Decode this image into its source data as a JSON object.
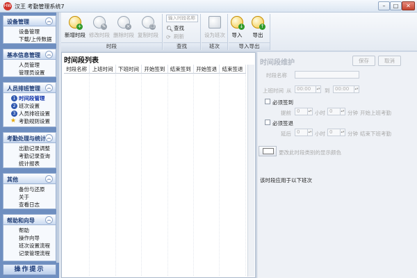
{
  "window": {
    "icon_text": "HW",
    "title": "汉王 考勤管理系统7",
    "minimize": "–",
    "maximize": "□",
    "close": "✕"
  },
  "sidebar": {
    "sections": [
      {
        "title": "设备管理",
        "items": [
          "设备管理",
          "下载/上传数据"
        ]
      },
      {
        "title": "基本信息管理",
        "items": [
          "人员管理",
          "管理员设置"
        ]
      },
      {
        "title": "人员排班管理",
        "items": [
          {
            "num": "1",
            "label": "时间段管理",
            "active": true
          },
          {
            "num": "2",
            "label": "班次设置"
          },
          {
            "num": "3",
            "label": "人员排班设置"
          },
          {
            "star": "★",
            "label": "考勤规则设置"
          }
        ]
      },
      {
        "title": "考勤处理与统计",
        "items": [
          "出勤记录调整",
          "考勤记录查询",
          "统计报表"
        ]
      },
      {
        "title": "其他",
        "items": [
          "备份与还原",
          "关于",
          "查看日志"
        ]
      },
      {
        "title": "帮助和向导",
        "items": [
          "帮助",
          "操作向导",
          "班次设置流程",
          "记录管理流程"
        ]
      }
    ],
    "collapse_glyph": "︽",
    "tip_label": "操作提示"
  },
  "toolbar": {
    "group_timeslot": {
      "label": "时段",
      "buttons": [
        {
          "label": "新增时段",
          "enabled": true,
          "badge": "+"
        },
        {
          "label": "修改时段",
          "enabled": false,
          "badge": "✎"
        },
        {
          "label": "删除时段",
          "enabled": false,
          "badge": "×"
        },
        {
          "label": "复制时段",
          "enabled": false,
          "badge": "❐"
        }
      ]
    },
    "group_search": {
      "label": "查找",
      "input_placeholder": "输入时段名称",
      "find_label": "查找",
      "refresh_label": "刷新"
    },
    "group_shift": {
      "label": "班次",
      "button_label": "设为班次"
    },
    "group_io": {
      "label": "导入导出",
      "import_label": "导入",
      "export_label": "导出"
    }
  },
  "list_panel": {
    "title": "时间段列表",
    "columns": [
      "时段名称",
      "上班时间",
      "下班时间",
      "开始签到",
      "结束签到",
      "开始签退",
      "结束签退"
    ]
  },
  "detail_panel": {
    "title": "时间段维护",
    "save_label": "保存",
    "cancel_label": "取消",
    "name_label": "时段名称",
    "work_time_label": "上班时间",
    "from_label": "从",
    "to_label": "到",
    "start_time": "00:00",
    "end_time": "00:00",
    "must_signin_label": "必须签到",
    "advance_label": "提前",
    "hours_label": "小时",
    "minutes_label": "分钟",
    "start_signin_label": "开始上班考勤",
    "must_signout_label": "必须签退",
    "delay_label": "延后",
    "end_signout_label": "结束下班考勤",
    "hour_value": "0",
    "minute_value": "0",
    "color_label": "更改此时段类别的显示颜色",
    "applies_label": "该时段应用于以下班次"
  }
}
